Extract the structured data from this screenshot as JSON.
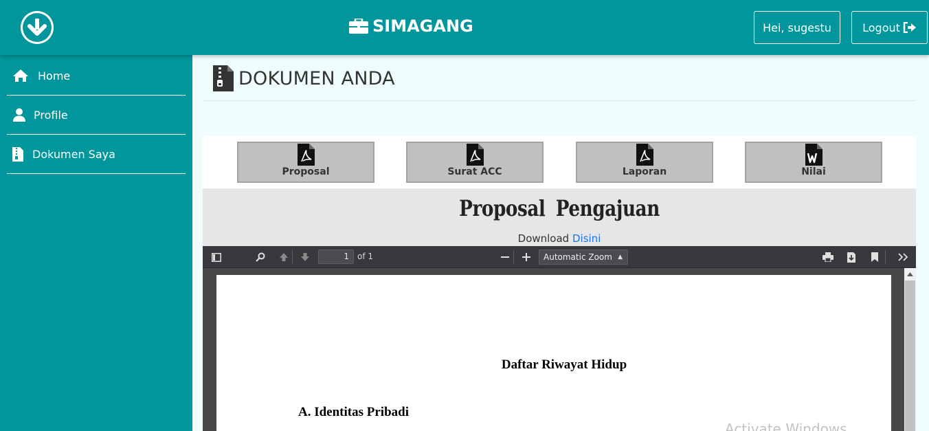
{
  "header": {
    "brand": "SIMAGANG",
    "user_label": "Hei, sugestu",
    "logout_label": "Logout",
    "accent_color": "#00969b"
  },
  "sidebar": {
    "items": [
      {
        "label": "Home",
        "icon": "home-icon"
      },
      {
        "label": "Profile",
        "icon": "user-icon"
      },
      {
        "label": "Dokumen Saya",
        "icon": "file-zip-icon"
      }
    ]
  },
  "main": {
    "page_title": "DOKUMEN ANDA",
    "page_icon": "file-zip-icon",
    "documents": [
      {
        "label": "Proposal",
        "icon": "pdf-file-icon"
      },
      {
        "label": "Surat ACC",
        "icon": "pdf-file-icon"
      },
      {
        "label": "Laporan",
        "icon": "pdf-file-icon"
      },
      {
        "label": "Nilai",
        "icon": "word-file-icon"
      }
    ],
    "viewer_title": "Proposal Pengajuan",
    "download_text": "Download",
    "download_link": "Disini"
  },
  "pdf_viewer": {
    "page_number": "1",
    "page_count": "of 1",
    "zoom": "Automatic Zoom",
    "content": {
      "heading": "Daftar Riwayat Hidup",
      "section": "A. Identitas Pribadi"
    }
  },
  "overlay": {
    "watermark": "Activate Windows"
  }
}
